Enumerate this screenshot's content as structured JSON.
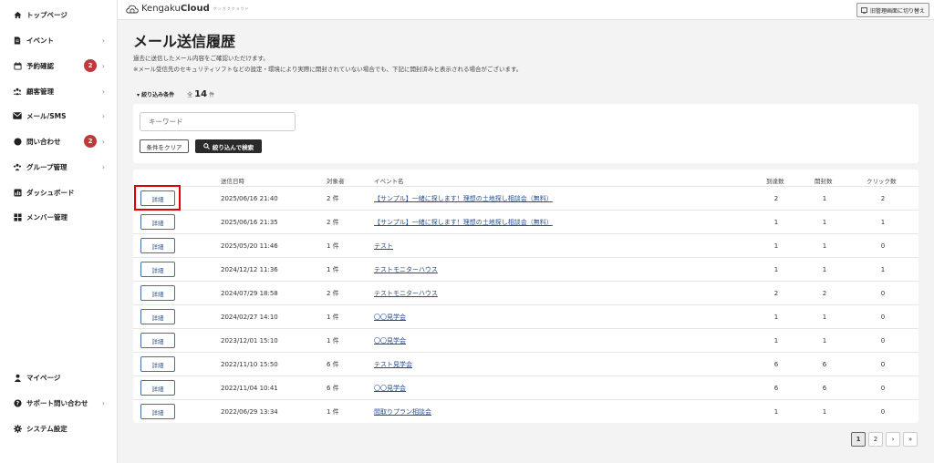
{
  "sidebar": {
    "items": [
      {
        "label": "トップページ",
        "icon": "home-icon",
        "chevron": false,
        "badge": null
      },
      {
        "label": "イベント",
        "icon": "document-icon",
        "chevron": true,
        "badge": null
      },
      {
        "label": "予約確認",
        "icon": "calendar-icon",
        "chevron": true,
        "badge": "2"
      },
      {
        "label": "顧客管理",
        "icon": "users-icon",
        "chevron": true,
        "badge": null
      },
      {
        "label": "メール/SMS",
        "icon": "mail-icon",
        "chevron": true,
        "badge": null
      },
      {
        "label": "問い合わせ",
        "icon": "chat-icon",
        "chevron": true,
        "badge": "2"
      },
      {
        "label": "グループ管理",
        "icon": "group-icon",
        "chevron": true,
        "badge": null
      },
      {
        "label": "ダッシュボード",
        "icon": "chart-icon",
        "chevron": false,
        "badge": null
      },
      {
        "label": "メンバー管理",
        "icon": "grid-icon",
        "chevron": false,
        "badge": null
      }
    ],
    "bottom_items": [
      {
        "label": "マイページ",
        "icon": "person-icon",
        "chevron": false
      },
      {
        "label": "サポート問い合わせ",
        "icon": "help-icon",
        "chevron": true
      },
      {
        "label": "システム設定",
        "icon": "gear-icon",
        "chevron": false
      }
    ]
  },
  "header": {
    "logo_text": "Kengaku",
    "logo_bold": "Cloud",
    "logo_sub": "ケンガククラウド",
    "switch_label": "旧管理画面に切り替え"
  },
  "page": {
    "title": "メール送信履歴",
    "desc1": "過去に送信したメール内容をご確認いただけます。",
    "desc2": "※メール受信先のセキュリティソフトなどの設定・環境により実際に開封されていない場合でも、下記に開封済みと表示される場合がございます。"
  },
  "filter": {
    "label": "絞り込み条件",
    "total_prefix": "全",
    "total_count": "14",
    "total_suffix": "件",
    "keyword_placeholder": "キーワード",
    "clear_label": "条件をクリア",
    "search_label": "絞り込んで検索"
  },
  "table": {
    "headers": [
      "送信日時",
      "対象者",
      "イベント名",
      "到達数",
      "開封数",
      "クリック数"
    ],
    "detail_label": "詳細",
    "rows": [
      {
        "date": "2025/06/16 21:40",
        "target": "2 件",
        "event": "【サンプル】一緒に探します！理想の土地探し相談会（無料）",
        "reached": "2",
        "opened": "1",
        "clicked": "2"
      },
      {
        "date": "2025/06/16 21:35",
        "target": "2 件",
        "event": "【サンプル】一緒に探します！理想の土地探し相談会（無料）",
        "reached": "1",
        "opened": "1",
        "clicked": "1"
      },
      {
        "date": "2025/05/20 11:46",
        "target": "1 件",
        "event": "テスト",
        "reached": "1",
        "opened": "1",
        "clicked": "0"
      },
      {
        "date": "2024/12/12 11:36",
        "target": "1 件",
        "event": "テストモニターハウス",
        "reached": "1",
        "opened": "1",
        "clicked": "1"
      },
      {
        "date": "2024/07/29 18:58",
        "target": "2 件",
        "event": "テストモニターハウス",
        "reached": "2",
        "opened": "2",
        "clicked": "0"
      },
      {
        "date": "2024/02/27 14:10",
        "target": "1 件",
        "event": "〇〇見学会",
        "reached": "1",
        "opened": "1",
        "clicked": "0"
      },
      {
        "date": "2023/12/01 15:10",
        "target": "1 件",
        "event": "〇〇見学会",
        "reached": "1",
        "opened": "1",
        "clicked": "0"
      },
      {
        "date": "2022/11/10 15:50",
        "target": "6 件",
        "event": "テスト見学会",
        "reached": "6",
        "opened": "6",
        "clicked": "0"
      },
      {
        "date": "2022/11/04 10:41",
        "target": "6 件",
        "event": "〇〇見学会",
        "reached": "6",
        "opened": "6",
        "clicked": "0"
      },
      {
        "date": "2022/06/29 13:34",
        "target": "1 件",
        "event": "間取りプラン相談会",
        "reached": "1",
        "opened": "1",
        "clicked": "0"
      }
    ]
  },
  "pagination": {
    "pages": [
      "1",
      "2"
    ],
    "next": "›",
    "last": "»"
  },
  "colors": {
    "badge": "#c0393b",
    "link": "#2a4d8f",
    "highlight": "#e00000",
    "search_button": "#2a2a2a"
  }
}
